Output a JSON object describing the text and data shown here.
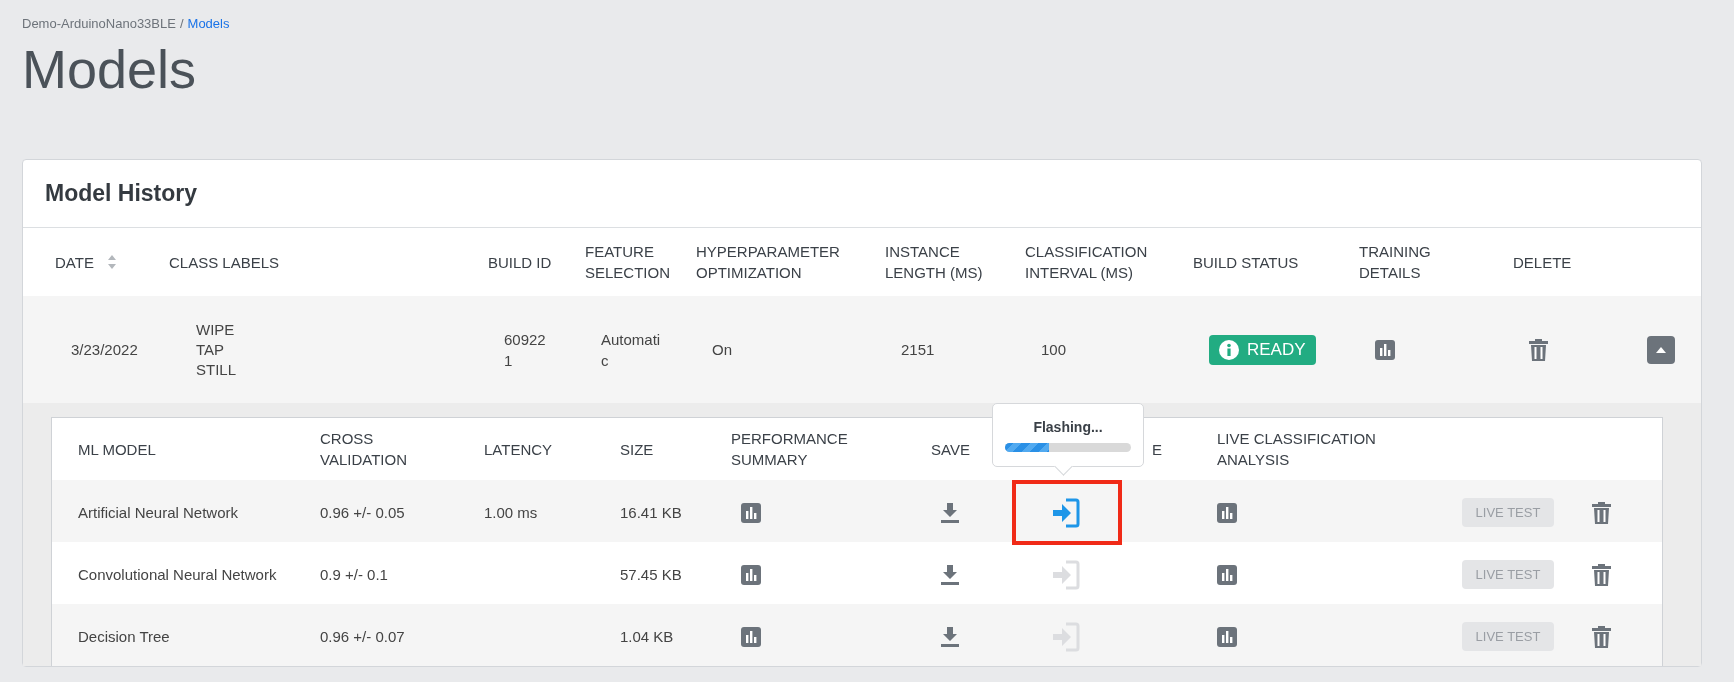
{
  "breadcrumb": {
    "items": [
      {
        "label": "Demo-ArduinoNano33BLE",
        "current": false
      },
      {
        "label": "Models",
        "current": true
      }
    ],
    "separator": "/"
  },
  "title": "Models",
  "card": {
    "title": "Model History",
    "columns": [
      {
        "label": "DATE",
        "sortable": true
      },
      {
        "label": "CLASS LABELS",
        "sortable": false
      },
      {
        "label": "BUILD ID",
        "sortable": false
      },
      {
        "label": "FEATURE SELECTION",
        "sortable": false
      },
      {
        "label": "HYPERPARAMETER OPTIMIZATION",
        "sortable": false
      },
      {
        "label": "INSTANCE LENGTH (MS)",
        "sortable": false
      },
      {
        "label": "CLASSIFICATION INTERVAL (MS)",
        "sortable": false
      },
      {
        "label": "BUILD STATUS",
        "sortable": false
      },
      {
        "label": "TRAINING DETAILS",
        "sortable": false
      },
      {
        "label": "DELETE",
        "sortable": false
      }
    ],
    "rows": [
      {
        "date": "3/23/2022",
        "class_labels": [
          "WIPE",
          "TAP",
          "STILL"
        ],
        "build_id": "609221",
        "feature_selection": "Automatic",
        "hyperparameter_optimization": "On",
        "instance_length": "2151",
        "classification_interval": "100",
        "status": {
          "label": "READY",
          "kind": "ready"
        },
        "expanded": true,
        "models": {
          "columns": [
            "ML MODEL",
            "CROSS VALIDATION",
            "LATENCY",
            "SIZE",
            "PERFORMANCE SUMMARY",
            "SAVE",
            "E",
            "LIVE CLASSIFICATION ANALYSIS"
          ],
          "rows": [
            {
              "ml_model": "Artificial Neural Network",
              "cross_validation": "0.96 +/- 0.05",
              "latency": "1.00 ms",
              "size": "16.41 KB",
              "flash_enabled": true,
              "highlighted": true,
              "flash_progress": {
                "text": "Flashing...",
                "level": 0.35
              },
              "live_test": {
                "label": "LIVE TEST",
                "disabled": true
              }
            },
            {
              "ml_model": "Convolutional Neural Network",
              "cross_validation": "0.9 +/- 0.1",
              "size": "57.45 KB",
              "flash_enabled": false,
              "highlighted": false,
              "live_test": {
                "label": "LIVE TEST",
                "disabled": true
              }
            },
            {
              "ml_model": "Decision Tree",
              "cross_validation": "0.96 +/- 0.07",
              "size": "1.04 KB",
              "flash_enabled": false,
              "highlighted": false,
              "live_test": {
                "label": "LIVE TEST",
                "disabled": true
              }
            }
          ]
        }
      }
    ]
  }
}
